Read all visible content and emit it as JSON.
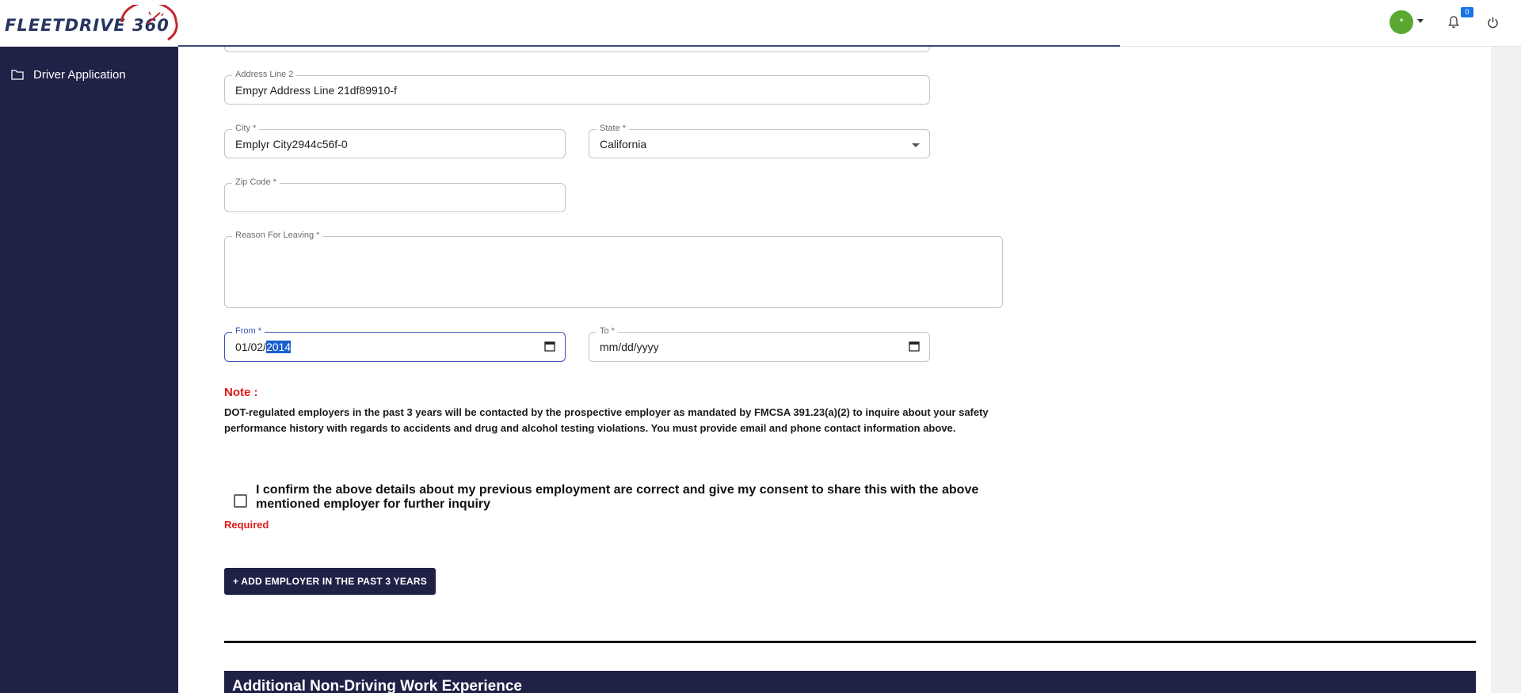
{
  "header": {
    "logo_text": "FLEETDRIVE 360",
    "avatar_initial": "*",
    "notification_count": "0"
  },
  "sidebar": {
    "items": [
      {
        "label": "Driver Application",
        "icon": "folder-icon"
      }
    ]
  },
  "form": {
    "address_line_2": {
      "label": "Address Line 2",
      "value": "Empyr Address Line 21df89910-f"
    },
    "city": {
      "label": "City *",
      "value": "Emplyr City2944c56f-0"
    },
    "state": {
      "label": "State *",
      "value": "California"
    },
    "zip": {
      "label": "Zip Code *",
      "value": ""
    },
    "reason": {
      "label": "Reason For Leaving *",
      "value": ""
    },
    "from": {
      "label": "From *",
      "month": "01",
      "day": "02",
      "year": "2014"
    },
    "to": {
      "label": "To *",
      "placeholder": "mm/dd/yyyy"
    }
  },
  "note": {
    "title": "Note :",
    "text": "DOT-regulated employers in the past 3 years will be contacted by the prospective employer as mandated by FMCSA 391.23(a)(2) to inquire about your safety performance history with regards to accidents and drug and alcohol testing violations. You must provide email and phone contact information above."
  },
  "consent": {
    "text": "I confirm the above details about my previous employment are correct and give my consent to share this with the above mentioned employer for further inquiry",
    "checked": false,
    "error": "Required"
  },
  "actions": {
    "add_employer_label": "+ ADD EMPLOYER IN THE PAST 3 YEARS"
  },
  "section": {
    "title": "Additional Non-Driving Work Experience"
  },
  "colors": {
    "sidebar": "#1f2147",
    "accent": "#3f51b5",
    "error": "#e01b1b",
    "avatar": "#5aa832",
    "badge": "#1a73e8"
  }
}
